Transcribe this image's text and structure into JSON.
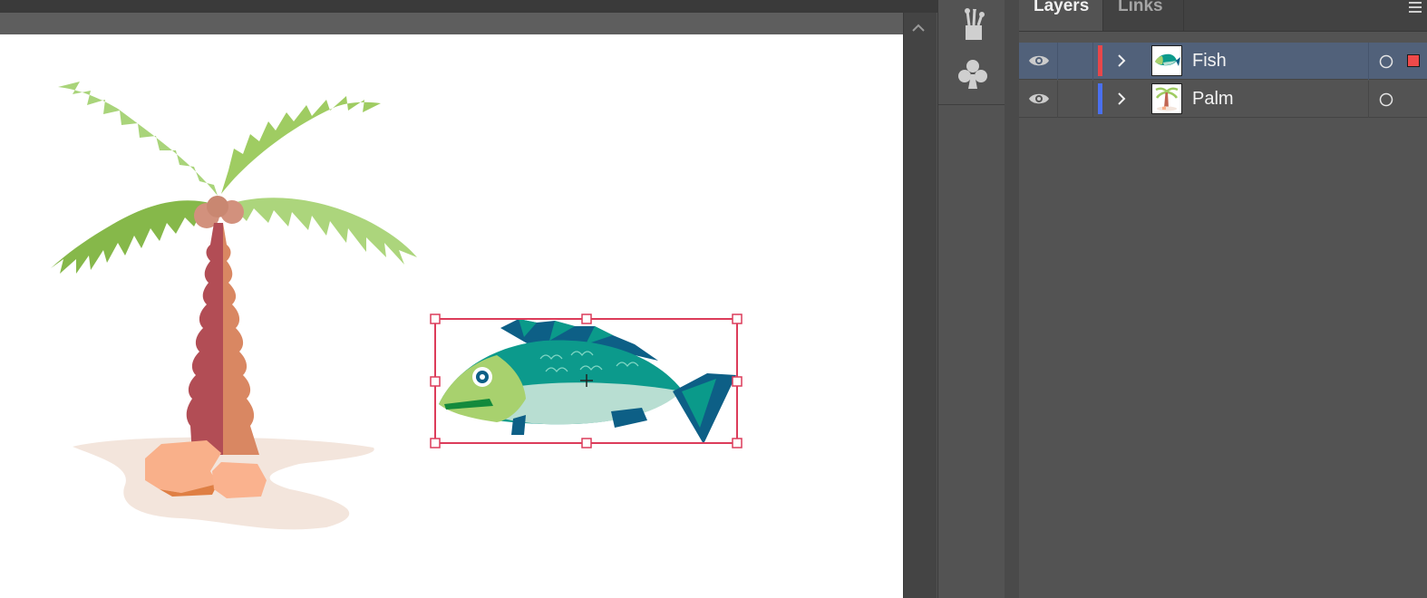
{
  "panel": {
    "tabs": [
      {
        "label": "Layers",
        "active": true
      },
      {
        "label": "Links",
        "active": false
      }
    ]
  },
  "layers": [
    {
      "name": "Fish",
      "visible": true,
      "selected": true,
      "color": "#e8474a",
      "thumb": "fish"
    },
    {
      "name": "Palm",
      "visible": true,
      "selected": false,
      "color": "#4a70ef",
      "thumb": "palm"
    }
  ],
  "dock": {
    "icons": [
      "brushes-icon",
      "symbols-club-icon"
    ]
  },
  "colors": {
    "selection": "#dc3c5a",
    "panel_bg": "#535353",
    "selected_row": "#51617a"
  }
}
